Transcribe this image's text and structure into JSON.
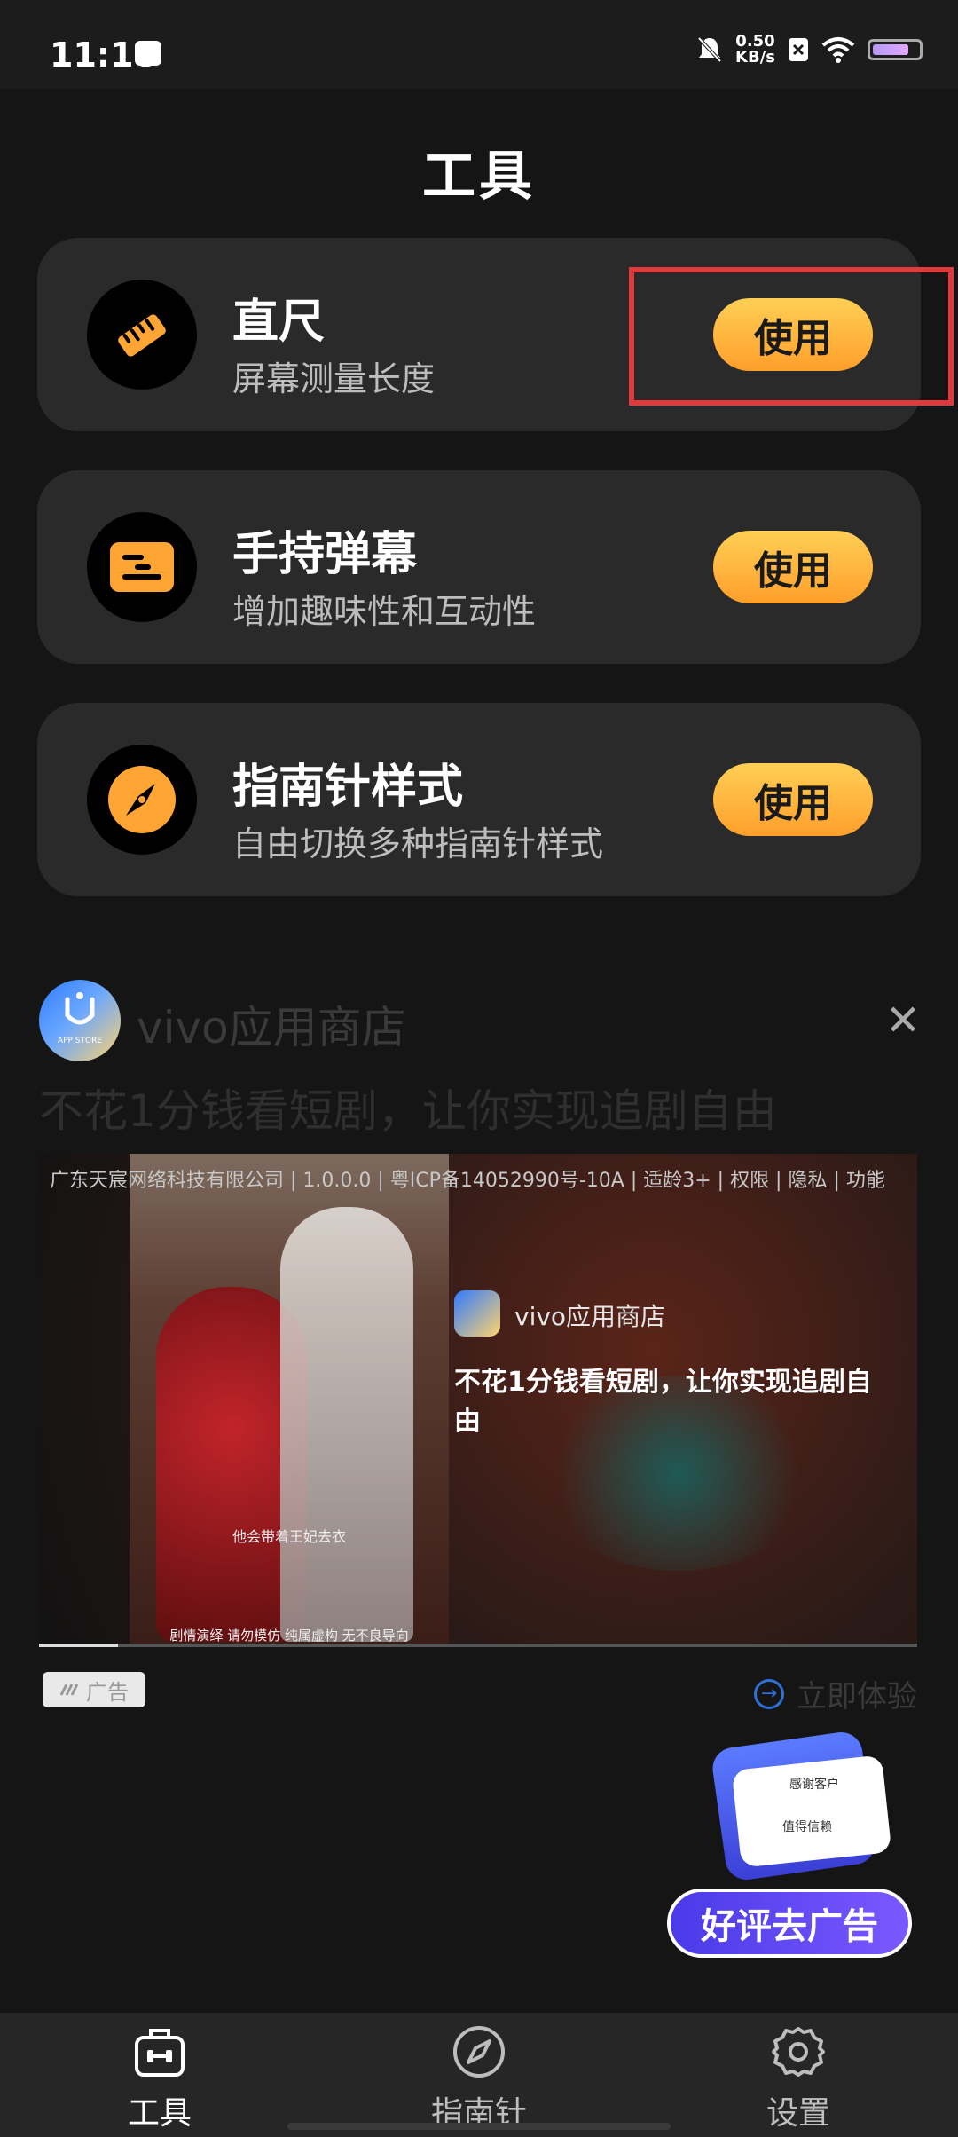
{
  "status_bar": {
    "time": "11:16",
    "speed_value": "0.50",
    "speed_unit": "KB/s",
    "battery_level": 0.8
  },
  "page": {
    "title": "工具"
  },
  "tools": [
    {
      "title": "直尺",
      "desc": "屏幕测量长度",
      "button": "使用",
      "icon": "ruler-icon"
    },
    {
      "title": "手持弹幕",
      "desc": "增加趣味性和互动性",
      "button": "使用",
      "icon": "danmaku-icon"
    },
    {
      "title": "指南针样式",
      "desc": "自由切换多种指南针样式",
      "button": "使用",
      "icon": "compass-icon"
    }
  ],
  "ad": {
    "logo_text": "APP STORE",
    "brand": "vivo应用商店",
    "close": "✕",
    "headline": "不花1分钱看短剧，让你实现追剧自由",
    "legal_line": "广东天宸网络科技有限公司 | 1.0.0.0 | 粤ICP备14052990号-10A | 适龄3+ | 权限 | 隐私 | 功能",
    "poster_caption_1": "他会带着王妃去衣",
    "poster_caption_2": "剧情演绎 请勿模仿 纯属虚构 无不良导向",
    "media_brand": "vivo应用商店",
    "media_headline": "不花1分钱看短剧，让你实现追剧自由",
    "video_progress": 0.09,
    "badge": "广告",
    "cta": "立即体验"
  },
  "floating_promo": {
    "label_1": "感谢客户",
    "label_2": "值得信赖",
    "button": "好评去广告"
  },
  "bottom_nav": [
    {
      "label": "工具",
      "icon": "toolbox-icon",
      "active": true
    },
    {
      "label": "指南针",
      "icon": "compass-nav-icon",
      "active": false
    },
    {
      "label": "设置",
      "icon": "settings-gear-icon",
      "active": false
    }
  ],
  "colors": {
    "background": "#151515",
    "card": "#2a2a2a",
    "accent_orange": "#ffb33d",
    "highlight_red": "#e0393e",
    "promo_purple": "#5b45f0"
  }
}
